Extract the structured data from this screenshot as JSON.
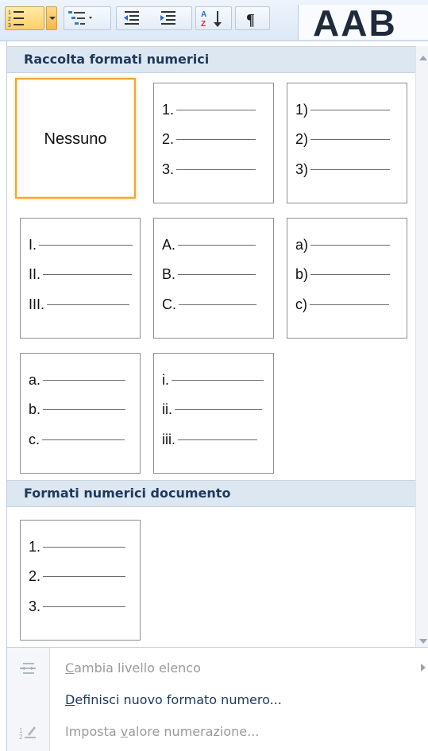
{
  "ribbon": {
    "styles_preview_text": "AAB"
  },
  "gallery": {
    "section_title": "Raccolta formati numerici",
    "none_label": "Nessuno",
    "tiles": [
      {
        "labels": [
          "1.",
          "2.",
          "3."
        ]
      },
      {
        "labels": [
          "1)",
          "2)",
          "3)"
        ]
      },
      {
        "labels": [
          "I.",
          "II.",
          "III."
        ]
      },
      {
        "labels": [
          "A.",
          "B.",
          "C."
        ]
      },
      {
        "labels": [
          "a)",
          "b)",
          "c)"
        ]
      },
      {
        "labels": [
          "a.",
          "b.",
          "c."
        ]
      },
      {
        "labels": [
          "i.",
          "ii.",
          "iii."
        ]
      }
    ]
  },
  "document_formats": {
    "section_title": "Formati numerici documento",
    "tiles": [
      {
        "labels": [
          "1.",
          "2.",
          "3."
        ]
      }
    ]
  },
  "commands": {
    "change_level": {
      "accel": "C",
      "rest": "ambia livello elenco",
      "enabled": false,
      "has_submenu": true
    },
    "define_new": {
      "accel": "D",
      "rest": "efinisci nuovo formato numero...",
      "enabled": true
    },
    "set_value": {
      "pre": "Imposta ",
      "accel": "v",
      "rest": "alore numerazione...",
      "enabled": false
    }
  },
  "colors": {
    "header_bg": "#dde7f1",
    "header_text": "#1e395b",
    "selected_border": "#f0a63a",
    "disabled_text": "#9a9a9a"
  }
}
